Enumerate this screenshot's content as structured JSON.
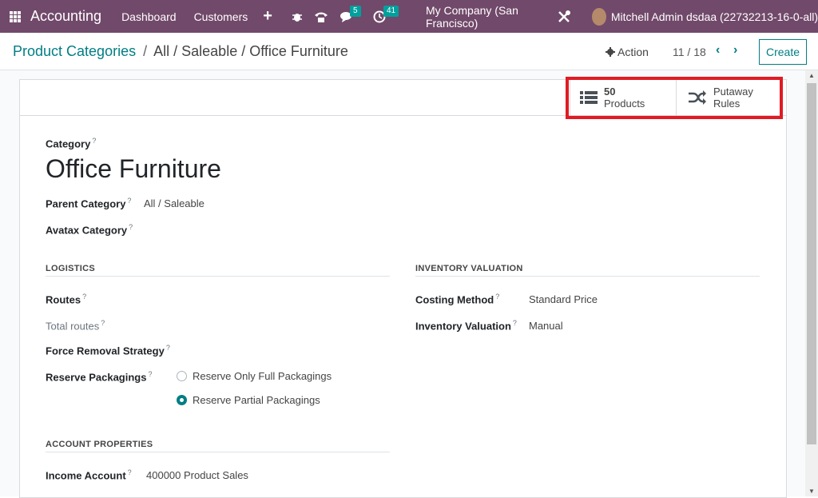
{
  "navbar": {
    "app_name": "Accounting",
    "menu": [
      "Dashboard",
      "Customers"
    ],
    "plus": "+",
    "messages_badge": "5",
    "activities_badge": "41",
    "company": "My Company (San Francisco)",
    "user": "Mitchell Admin dsdaa (22732213-16-0-all)",
    "color": "#71496a"
  },
  "control": {
    "breadcrumb_link": "Product Categories",
    "breadcrumb_sep": "/",
    "breadcrumb_current": "All / Saleable / Office Furniture",
    "action_label": "Action",
    "pager": "11 / 18",
    "prev": "‹",
    "next": "›",
    "create_label": "Create"
  },
  "buttons": {
    "products_count": "50",
    "products_label": "Products",
    "putaway_line1": "Putaway",
    "putaway_line2": "Rules"
  },
  "form": {
    "category_label": "Category",
    "title": "Office Furniture",
    "parent_label": "Parent Category",
    "parent_value": "All / Saleable",
    "avatax_label": "Avatax Category",
    "help_mark": "?",
    "logistics_title": "LOGISTICS",
    "routes_label": "Routes",
    "total_routes_label": "Total routes",
    "force_removal_label": "Force Removal Strategy",
    "reserve_label": "Reserve Packagings",
    "reserve_option1": "Reserve Only Full Packagings",
    "reserve_option2": "Reserve Partial Packagings",
    "reserve_selected": "Reserve Partial Packagings",
    "inventory_title": "INVENTORY VALUATION",
    "costing_label": "Costing Method",
    "costing_value": "Standard Price",
    "inv_val_label": "Inventory Valuation",
    "inv_val_value": "Manual",
    "account_title": "ACCOUNT PROPERTIES",
    "income_label": "Income Account",
    "income_value": "400000 Product Sales"
  },
  "colors": {
    "accent": "#017e84",
    "highlight": "#e01b24"
  }
}
